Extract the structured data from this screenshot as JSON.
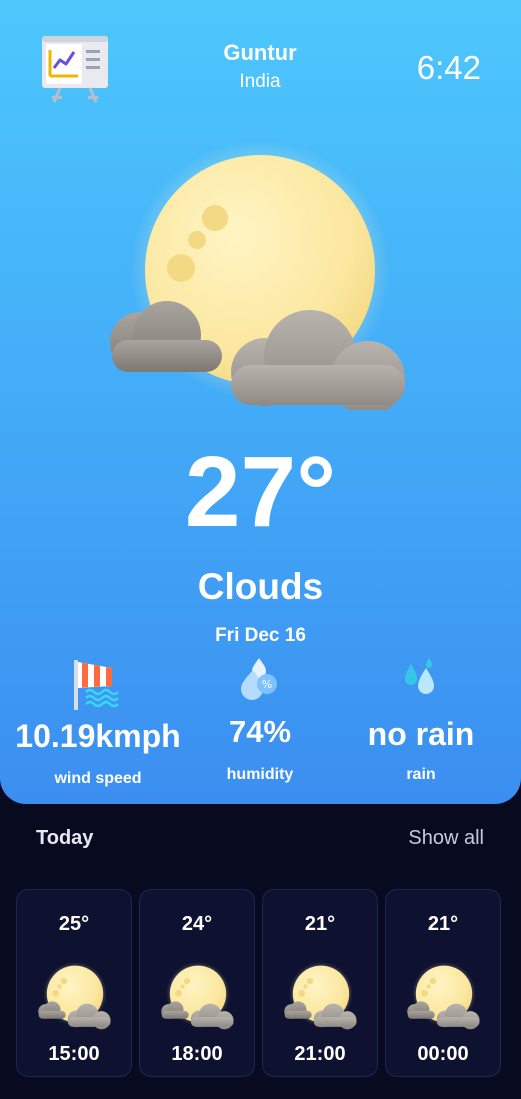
{
  "header": {
    "app_icon": "chart-board-icon",
    "city": "Guntur",
    "country": "India",
    "time": "6:42"
  },
  "current": {
    "icon": "moon-clouds-icon",
    "temperature": "27°",
    "condition": "Clouds",
    "date": "Fri Dec 16"
  },
  "stats": {
    "wind": {
      "icon": "windsock-icon",
      "value": "10.19kmph",
      "label": "wind speed"
    },
    "humidity": {
      "icon": "humidity-drops-icon",
      "value": "74%",
      "label": "humidity"
    },
    "rain": {
      "icon": "rain-drops-icon",
      "value": "no rain",
      "label": "rain"
    }
  },
  "forecast": {
    "title": "Today",
    "show_all_label": "Show all",
    "hours": [
      {
        "temp": "25°",
        "time": "15:00",
        "icon": "moon-clouds-icon"
      },
      {
        "temp": "24°",
        "time": "18:00",
        "icon": "moon-clouds-icon"
      },
      {
        "temp": "21°",
        "time": "21:00",
        "icon": "moon-clouds-icon"
      },
      {
        "temp": "21°",
        "time": "00:00",
        "icon": "moon-clouds-icon"
      }
    ]
  },
  "colors": {
    "hero_top": "#4dc7fc",
    "hero_bottom": "#3b8ef0",
    "background": "#080a1f",
    "card": "#0e1130",
    "moon": "#fbe9a4"
  }
}
